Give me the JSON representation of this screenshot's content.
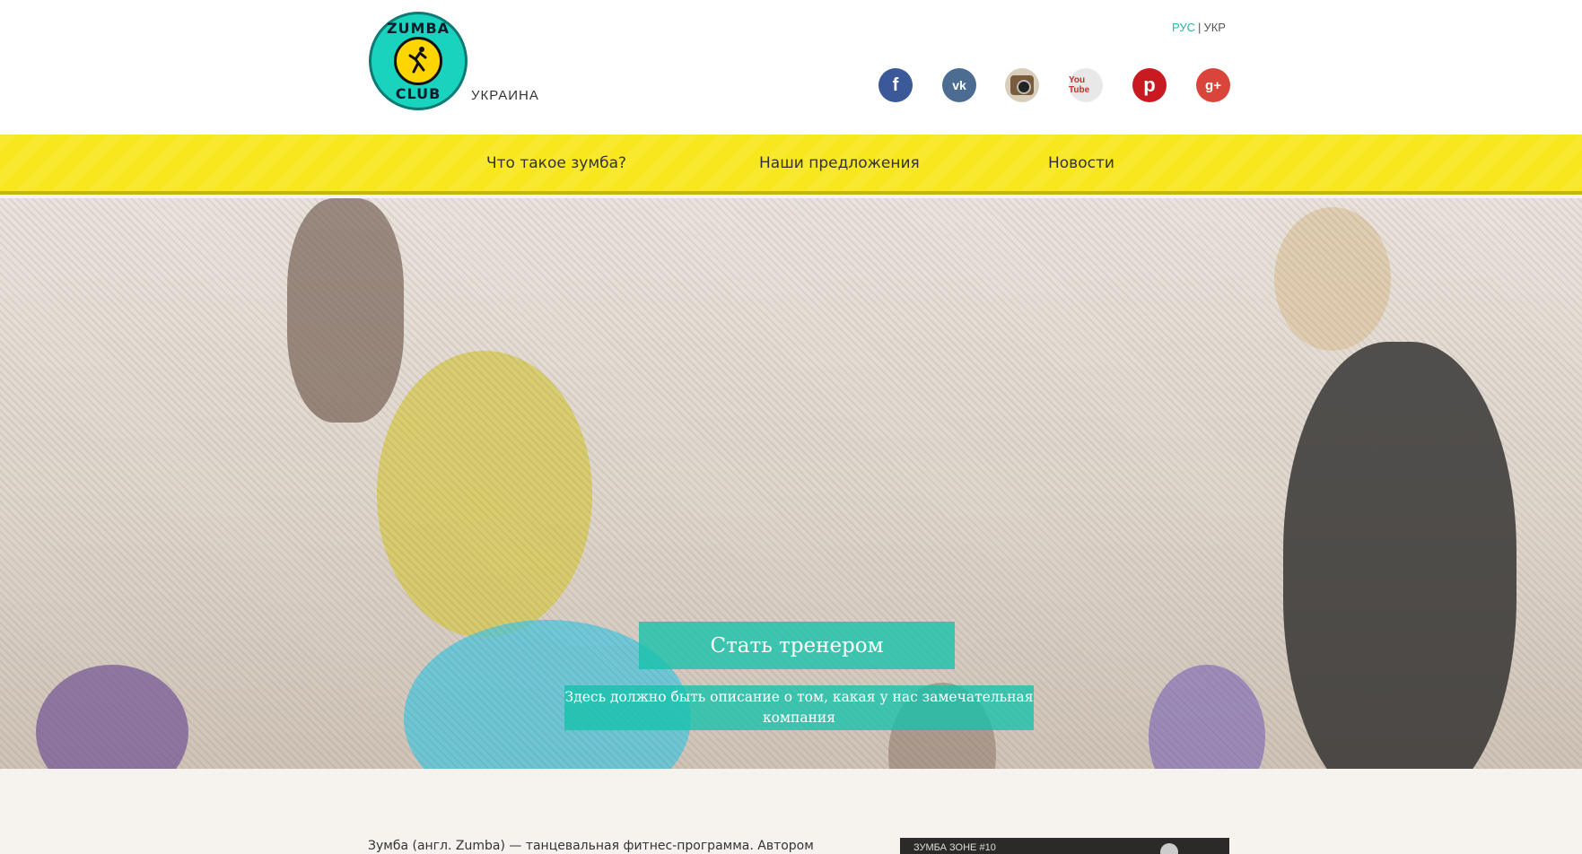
{
  "header": {
    "logo_text_top": "ZUMBA",
    "logo_text_bottom": "CLUB",
    "country": "УКРАИНА",
    "lang": {
      "active": "РУС",
      "separator": "|",
      "other": "УКР"
    },
    "social": [
      {
        "name": "facebook",
        "glyph": "f"
      },
      {
        "name": "vk",
        "glyph": "vk"
      },
      {
        "name": "instagram",
        "glyph": ""
      },
      {
        "name": "youtube",
        "glyph": "You Tube"
      },
      {
        "name": "pinterest",
        "glyph": "p"
      },
      {
        "name": "google-plus",
        "glyph": "g+"
      }
    ]
  },
  "nav": {
    "items": [
      {
        "label": "Что такое зумба?"
      },
      {
        "label": "Наши предложения"
      },
      {
        "label": "Новости"
      }
    ]
  },
  "hero": {
    "cta_label": "Стать тренером",
    "description": "Здесь должно быть описание о том, какая у нас замечательная компания"
  },
  "content": {
    "intro_text": "Зумба (англ. Zumba) — танцевальная фитнес-программа. Автором",
    "video_title": "ЗУМБА ЗОНЕ #10"
  },
  "colors": {
    "accent": "#24b8a7",
    "nav_bg": "#f8e71c",
    "cta_bg": "#14c2ab",
    "page_bg": "#f6f2ee"
  }
}
